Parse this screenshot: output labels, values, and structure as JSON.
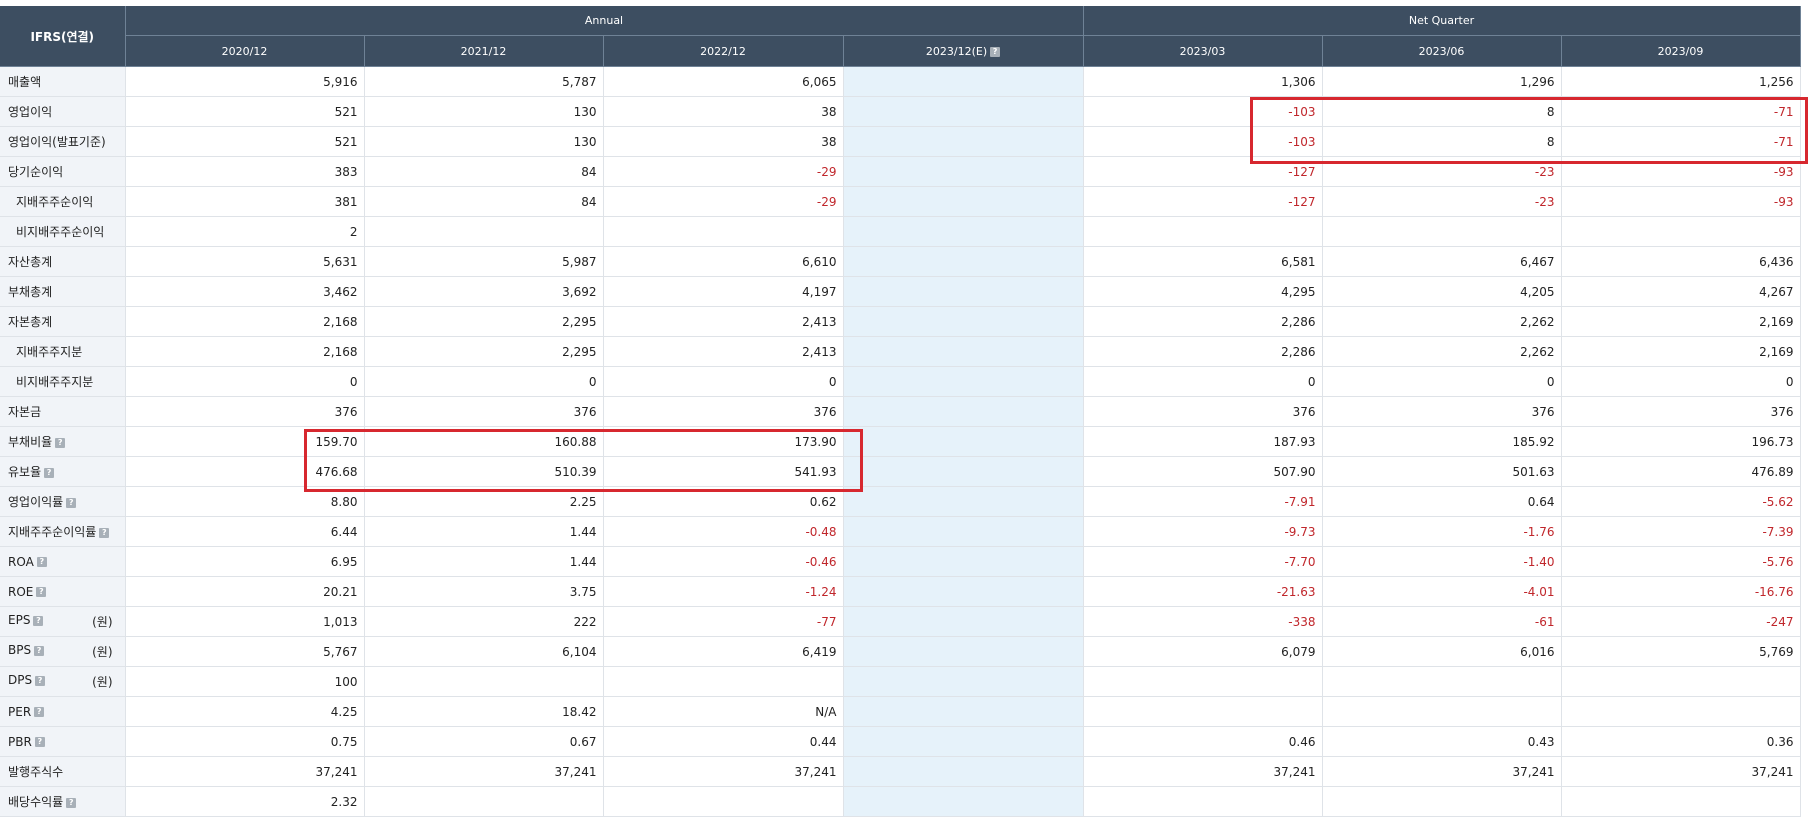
{
  "header": {
    "corner": "IFRS(연결)",
    "group_annual": "Annual",
    "group_quarter": "Net Quarter",
    "columns": [
      "2020/12",
      "2021/12",
      "2022/12",
      "2023/12(E)",
      "2023/03",
      "2023/06",
      "2023/09"
    ]
  },
  "rows": [
    {
      "label": "매출액",
      "indent": false,
      "help": false,
      "unit": "",
      "values": [
        "5,916",
        "5,787",
        "6,065",
        "",
        "1,306",
        "1,296",
        "1,256"
      ]
    },
    {
      "label": "영업이익",
      "indent": false,
      "help": false,
      "unit": "",
      "values": [
        "521",
        "130",
        "38",
        "",
        "-103",
        "8",
        "-71"
      ]
    },
    {
      "label": "영업이익(발표기준)",
      "indent": false,
      "help": false,
      "unit": "",
      "values": [
        "521",
        "130",
        "38",
        "",
        "-103",
        "8",
        "-71"
      ]
    },
    {
      "label": "당기순이익",
      "indent": false,
      "help": false,
      "unit": "",
      "values": [
        "383",
        "84",
        "-29",
        "",
        "-127",
        "-23",
        "-93"
      ]
    },
    {
      "label": "지배주주순이익",
      "indent": true,
      "help": false,
      "unit": "",
      "values": [
        "381",
        "84",
        "-29",
        "",
        "-127",
        "-23",
        "-93"
      ]
    },
    {
      "label": "비지배주주순이익",
      "indent": true,
      "help": false,
      "unit": "",
      "values": [
        "2",
        "",
        "",
        "",
        "",
        "",
        ""
      ]
    },
    {
      "label": "자산총계",
      "indent": false,
      "help": false,
      "unit": "",
      "values": [
        "5,631",
        "5,987",
        "6,610",
        "",
        "6,581",
        "6,467",
        "6,436"
      ]
    },
    {
      "label": "부채총계",
      "indent": false,
      "help": false,
      "unit": "",
      "values": [
        "3,462",
        "3,692",
        "4,197",
        "",
        "4,295",
        "4,205",
        "4,267"
      ]
    },
    {
      "label": "자본총계",
      "indent": false,
      "help": false,
      "unit": "",
      "values": [
        "2,168",
        "2,295",
        "2,413",
        "",
        "2,286",
        "2,262",
        "2,169"
      ]
    },
    {
      "label": "지배주주지분",
      "indent": true,
      "help": false,
      "unit": "",
      "values": [
        "2,168",
        "2,295",
        "2,413",
        "",
        "2,286",
        "2,262",
        "2,169"
      ]
    },
    {
      "label": "비지배주주지분",
      "indent": true,
      "help": false,
      "unit": "",
      "values": [
        "0",
        "0",
        "0",
        "",
        "0",
        "0",
        "0"
      ]
    },
    {
      "label": "자본금",
      "indent": false,
      "help": false,
      "unit": "",
      "values": [
        "376",
        "376",
        "376",
        "",
        "376",
        "376",
        "376"
      ]
    },
    {
      "label": "부채비율",
      "indent": false,
      "help": true,
      "unit": "",
      "values": [
        "159.70",
        "160.88",
        "173.90",
        "",
        "187.93",
        "185.92",
        "196.73"
      ]
    },
    {
      "label": "유보율",
      "indent": false,
      "help": true,
      "unit": "",
      "values": [
        "476.68",
        "510.39",
        "541.93",
        "",
        "507.90",
        "501.63",
        "476.89"
      ]
    },
    {
      "label": "영업이익률",
      "indent": false,
      "help": true,
      "unit": "",
      "values": [
        "8.80",
        "2.25",
        "0.62",
        "",
        "-7.91",
        "0.64",
        "-5.62"
      ]
    },
    {
      "label": "지배주주순이익률",
      "indent": false,
      "help": true,
      "unit": "",
      "values": [
        "6.44",
        "1.44",
        "-0.48",
        "",
        "-9.73",
        "-1.76",
        "-7.39"
      ]
    },
    {
      "label": "ROA",
      "indent": false,
      "help": true,
      "unit": "",
      "values": [
        "6.95",
        "1.44",
        "-0.46",
        "",
        "-7.70",
        "-1.40",
        "-5.76"
      ]
    },
    {
      "label": "ROE",
      "indent": false,
      "help": true,
      "unit": "",
      "values": [
        "20.21",
        "3.75",
        "-1.24",
        "",
        "-21.63",
        "-4.01",
        "-16.76"
      ]
    },
    {
      "label": "EPS",
      "indent": false,
      "help": true,
      "unit": "(원)",
      "values": [
        "1,013",
        "222",
        "-77",
        "",
        "-338",
        "-61",
        "-247"
      ]
    },
    {
      "label": "BPS",
      "indent": false,
      "help": true,
      "unit": "(원)",
      "values": [
        "5,767",
        "6,104",
        "6,419",
        "",
        "6,079",
        "6,016",
        "5,769"
      ]
    },
    {
      "label": "DPS",
      "indent": false,
      "help": true,
      "unit": "(원)",
      "values": [
        "100",
        "",
        "",
        "",
        "",
        "",
        ""
      ]
    },
    {
      "label": "PER",
      "indent": false,
      "help": true,
      "unit": "",
      "values": [
        "4.25",
        "18.42",
        "N/A",
        "",
        "",
        "",
        ""
      ]
    },
    {
      "label": "PBR",
      "indent": false,
      "help": true,
      "unit": "",
      "values": [
        "0.75",
        "0.67",
        "0.44",
        "",
        "0.46",
        "0.43",
        "0.36"
      ]
    },
    {
      "label": "발행주식수",
      "indent": false,
      "help": false,
      "unit": "",
      "values": [
        "37,241",
        "37,241",
        "37,241",
        "",
        "37,241",
        "37,241",
        "37,241"
      ]
    },
    {
      "label": "배당수익률",
      "indent": false,
      "help": true,
      "unit": "",
      "values": [
        "2.32",
        "",
        "",
        "",
        "",
        "",
        ""
      ]
    }
  ],
  "colors": {
    "header_bg": "#3d4e61",
    "negative": "#c0262b",
    "estimate_col": "#e6f2fa",
    "highlight": "#d7282f"
  }
}
